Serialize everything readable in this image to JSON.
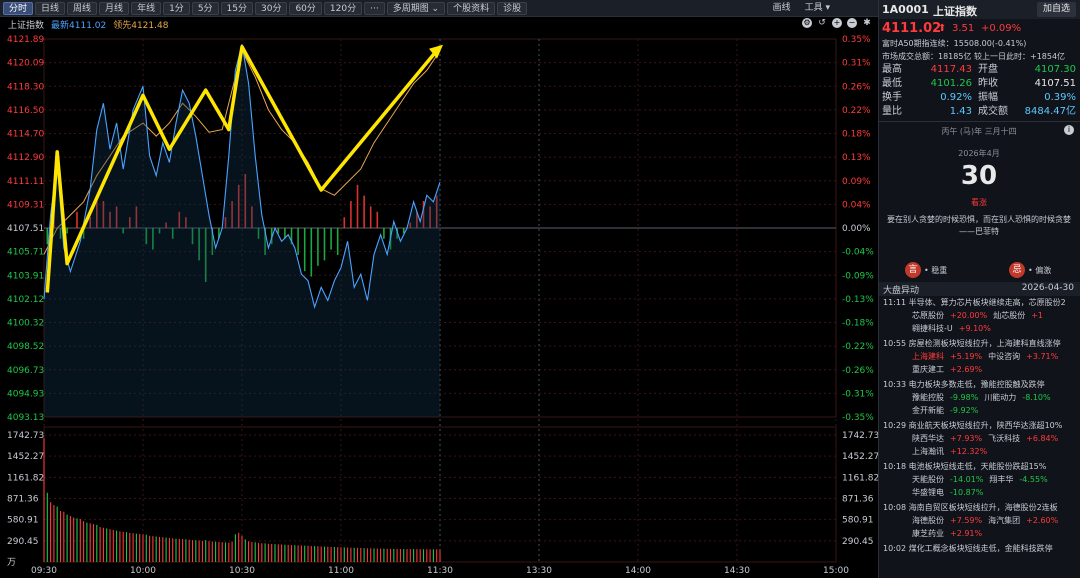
{
  "toolbar": {
    "tabs": [
      "分时",
      "日线",
      "周线",
      "月线",
      "年线",
      "1分",
      "5分",
      "15分",
      "30分",
      "60分",
      "120分",
      "···",
      "多周期图 ⌄",
      "个股资料",
      "诊股"
    ],
    "active_tab": 0,
    "right": [
      "画线",
      "工具 ▾"
    ]
  },
  "chart": {
    "index_name": "上证指数",
    "latest_label": "最新4111.02",
    "lead_label": "领先4121.48",
    "price_ticks": [
      "4121.89",
      "4120.09",
      "4118.30",
      "4116.50",
      "4114.70",
      "4112.90",
      "4111.11",
      "4109.31",
      "4107.51",
      "4105.71",
      "4103.91",
      "4102.12",
      "4100.32",
      "4098.52",
      "4096.73",
      "4094.93",
      "4093.13"
    ],
    "pct_ticks": [
      "0.35%",
      "0.31%",
      "0.26%",
      "0.22%",
      "0.18%",
      "0.13%",
      "0.09%",
      "0.04%",
      "0.00%",
      "-0.04%",
      "-0.09%",
      "-0.13%",
      "-0.18%",
      "-0.22%",
      "-0.26%",
      "-0.31%",
      "-0.35%"
    ],
    "vol_ticks": [
      "1742.73",
      "1452.27",
      "1161.82",
      "871.36",
      "580.91",
      "290.45",
      "万"
    ],
    "time_ticks": [
      "09:30",
      "10:00",
      "10:30",
      "11:00",
      "11:30",
      "13:30",
      "14:00",
      "14:30",
      "15:00"
    ],
    "prev_close": 4107.51,
    "colors": {
      "up": "#ff3b3b",
      "down": "#1ec74a",
      "price_line": "#4aa3ff",
      "avg_line": "#e8a64e",
      "annotation": "#ffe600"
    }
  },
  "chart_data": {
    "type": "line",
    "x_range": [
      "09:30",
      "15:00"
    ],
    "ylim": [
      4093.13,
      4121.89
    ],
    "price_series": [
      [
        "09:30",
        4102.1
      ],
      [
        "09:32",
        4108.5
      ],
      [
        "09:34",
        4112.5
      ],
      [
        "09:36",
        4106.0
      ],
      [
        "09:38",
        4104.2
      ],
      [
        "09:41",
        4106.5
      ],
      [
        "09:44",
        4110.5
      ],
      [
        "09:46",
        4115.0
      ],
      [
        "09:48",
        4117.0
      ],
      [
        "09:50",
        4113.5
      ],
      [
        "09:52",
        4115.5
      ],
      [
        "09:54",
        4112.0
      ],
      [
        "09:57",
        4116.5
      ],
      [
        "10:00",
        4118.3
      ],
      [
        "10:02",
        4113.0
      ],
      [
        "10:04",
        4111.5
      ],
      [
        "10:06",
        4114.0
      ],
      [
        "10:08",
        4112.5
      ],
      [
        "10:10",
        4115.5
      ],
      [
        "10:12",
        4118.0
      ],
      [
        "10:14",
        4117.0
      ],
      [
        "10:16",
        4114.5
      ],
      [
        "10:18",
        4111.5
      ],
      [
        "10:20",
        4108.5
      ],
      [
        "10:22",
        4106.0
      ],
      [
        "10:24",
        4107.5
      ],
      [
        "10:26",
        4113.0
      ],
      [
        "10:28",
        4119.5
      ],
      [
        "10:30",
        4121.5
      ],
      [
        "10:32",
        4118.5
      ],
      [
        "10:34",
        4113.0
      ],
      [
        "10:36",
        4108.5
      ],
      [
        "10:38",
        4106.0
      ],
      [
        "10:40",
        4107.5
      ],
      [
        "10:42",
        4106.5
      ],
      [
        "10:44",
        4107.0
      ],
      [
        "10:46",
        4106.0
      ],
      [
        "10:48",
        4104.0
      ],
      [
        "10:50",
        4103.5
      ],
      [
        "10:52",
        4101.5
      ],
      [
        "10:54",
        4103.0
      ],
      [
        "10:56",
        4102.0
      ],
      [
        "10:58",
        4103.5
      ],
      [
        "11:00",
        4104.5
      ],
      [
        "11:02",
        4106.5
      ],
      [
        "11:04",
        4103.0
      ],
      [
        "11:06",
        4104.0
      ],
      [
        "11:08",
        4102.0
      ],
      [
        "11:10",
        4105.5
      ],
      [
        "11:12",
        4107.0
      ],
      [
        "11:14",
        4105.5
      ],
      [
        "11:16",
        4108.0
      ],
      [
        "11:18",
        4106.5
      ],
      [
        "11:20",
        4107.5
      ],
      [
        "11:22",
        4109.5
      ],
      [
        "11:24",
        4108.0
      ],
      [
        "11:26",
        4110.0
      ],
      [
        "11:28",
        4109.5
      ],
      [
        "11:30",
        4111.0
      ]
    ],
    "avg_series": [
      [
        "09:30",
        4105.5
      ],
      [
        "09:34",
        4107.5
      ],
      [
        "09:38",
        4108.5
      ],
      [
        "09:42",
        4109.5
      ],
      [
        "09:46",
        4111.5
      ],
      [
        "09:50",
        4113.0
      ],
      [
        "09:54",
        4114.5
      ],
      [
        "10:00",
        4115.5
      ],
      [
        "10:04",
        4114.5
      ],
      [
        "10:08",
        4115.5
      ],
      [
        "10:12",
        4117.0
      ],
      [
        "10:16",
        4116.0
      ],
      [
        "10:20",
        4114.8
      ],
      [
        "10:24",
        4115.0
      ],
      [
        "10:28",
        4119.0
      ],
      [
        "10:30",
        4121.0
      ],
      [
        "10:34",
        4119.0
      ],
      [
        "10:38",
        4116.5
      ],
      [
        "10:42",
        4115.0
      ],
      [
        "10:46",
        4114.0
      ],
      [
        "10:50",
        4112.5
      ],
      [
        "10:54",
        4110.5
      ],
      [
        "10:58",
        4110.0
      ],
      [
        "11:02",
        4111.0
      ],
      [
        "11:06",
        4112.0
      ],
      [
        "11:10",
        4114.0
      ],
      [
        "11:14",
        4115.5
      ],
      [
        "11:18",
        4117.0
      ],
      [
        "11:22",
        4118.5
      ],
      [
        "11:26",
        4119.5
      ],
      [
        "11:30",
        4121.0
      ]
    ],
    "pct_bars": [
      [
        "09:31",
        -0.03
      ],
      [
        "09:33",
        0.05
      ],
      [
        "09:35",
        -0.02
      ],
      [
        "09:37",
        -0.01
      ],
      [
        "09:40",
        0.03
      ],
      [
        "09:42",
        -0.02
      ],
      [
        "09:44",
        0.02
      ],
      [
        "09:46",
        0.06
      ],
      [
        "09:48",
        0.05
      ],
      [
        "09:50",
        0.03
      ],
      [
        "09:52",
        0.04
      ],
      [
        "09:54",
        -0.01
      ],
      [
        "09:56",
        0.02
      ],
      [
        "09:58",
        0.04
      ],
      [
        "10:01",
        -0.03
      ],
      [
        "10:03",
        -0.04
      ],
      [
        "10:05",
        -0.01
      ],
      [
        "10:07",
        0.01
      ],
      [
        "10:09",
        -0.02
      ],
      [
        "10:11",
        0.03
      ],
      [
        "10:13",
        0.02
      ],
      [
        "10:15",
        -0.03
      ],
      [
        "10:17",
        -0.06
      ],
      [
        "10:19",
        -0.1
      ],
      [
        "10:21",
        -0.05
      ],
      [
        "10:23",
        -0.02
      ],
      [
        "10:25",
        0.02
      ],
      [
        "10:27",
        0.05
      ],
      [
        "10:29",
        0.08
      ],
      [
        "10:31",
        0.1
      ],
      [
        "10:33",
        0.04
      ],
      [
        "10:35",
        -0.02
      ],
      [
        "10:37",
        -0.05
      ],
      [
        "10:39",
        -0.03
      ],
      [
        "10:41",
        -0.01
      ],
      [
        "10:43",
        -0.02
      ],
      [
        "10:45",
        -0.03
      ],
      [
        "10:47",
        -0.05
      ],
      [
        "10:49",
        -0.08
      ],
      [
        "10:51",
        -0.09
      ],
      [
        "10:53",
        -0.07
      ],
      [
        "10:55",
        -0.06
      ],
      [
        "10:57",
        -0.04
      ],
      [
        "10:59",
        -0.05
      ],
      [
        "11:01",
        0.02
      ],
      [
        "11:03",
        0.05
      ],
      [
        "11:05",
        0.08
      ],
      [
        "11:07",
        0.06
      ],
      [
        "11:09",
        0.04
      ],
      [
        "11:11",
        0.03
      ],
      [
        "11:13",
        -0.02
      ],
      [
        "11:15",
        -0.04
      ],
      [
        "11:17",
        -0.02
      ],
      [
        "11:19",
        -0.01
      ],
      [
        "11:21",
        0.01
      ],
      [
        "11:23",
        0.03
      ],
      [
        "11:25",
        0.05
      ],
      [
        "11:27",
        0.04
      ],
      [
        "11:29",
        0.06
      ]
    ],
    "volume_series": [
      [
        "09:30",
        1700
      ],
      [
        "09:31",
        950
      ],
      [
        "09:32",
        820
      ],
      [
        "09:33",
        780
      ],
      [
        "09:34",
        760
      ],
      [
        "09:35",
        700
      ],
      [
        "09:36",
        690
      ],
      [
        "09:37",
        650
      ],
      [
        "09:38",
        630
      ],
      [
        "09:39",
        610
      ],
      [
        "09:40",
        600
      ],
      [
        "09:41",
        590
      ],
      [
        "09:42",
        560
      ],
      [
        "09:43",
        540
      ],
      [
        "09:44",
        530
      ],
      [
        "09:45",
        520
      ],
      [
        "09:46",
        510
      ],
      [
        "09:47",
        480
      ],
      [
        "09:48",
        470
      ],
      [
        "09:49",
        460
      ],
      [
        "09:50",
        450
      ],
      [
        "09:51",
        440
      ],
      [
        "09:52",
        430
      ],
      [
        "09:53",
        420
      ],
      [
        "09:54",
        415
      ],
      [
        "09:55",
        410
      ],
      [
        "09:56",
        400
      ],
      [
        "09:57",
        395
      ],
      [
        "09:58",
        390
      ],
      [
        "09:59",
        385
      ],
      [
        "10:00",
        380
      ],
      [
        "10:01",
        375
      ],
      [
        "10:02",
        360
      ],
      [
        "10:03",
        355
      ],
      [
        "10:04",
        350
      ],
      [
        "10:05",
        345
      ],
      [
        "10:06",
        340
      ],
      [
        "10:07",
        335
      ],
      [
        "10:08",
        330
      ],
      [
        "10:09",
        325
      ],
      [
        "10:10",
        320
      ],
      [
        "10:11",
        318
      ],
      [
        "10:12",
        315
      ],
      [
        "10:13",
        312
      ],
      [
        "10:14",
        305
      ],
      [
        "10:15",
        300
      ],
      [
        "10:16",
        298
      ],
      [
        "10:17",
        295
      ],
      [
        "10:18",
        290
      ],
      [
        "10:19",
        300
      ],
      [
        "10:20",
        285
      ],
      [
        "10:21",
        280
      ],
      [
        "10:22",
        278
      ],
      [
        "10:23",
        275
      ],
      [
        "10:24",
        272
      ],
      [
        "10:25",
        268
      ],
      [
        "10:26",
        265
      ],
      [
        "10:27",
        280
      ],
      [
        "10:28",
        380
      ],
      [
        "10:29",
        400
      ],
      [
        "10:30",
        360
      ],
      [
        "10:31",
        310
      ],
      [
        "10:32",
        285
      ],
      [
        "10:33",
        275
      ],
      [
        "10:34",
        270
      ],
      [
        "10:35",
        262
      ],
      [
        "10:36",
        258
      ],
      [
        "10:37",
        255
      ],
      [
        "10:38",
        250
      ],
      [
        "10:39",
        248
      ],
      [
        "10:40",
        245
      ],
      [
        "10:41",
        242
      ],
      [
        "10:42",
        240
      ],
      [
        "10:43",
        238
      ],
      [
        "10:44",
        235
      ],
      [
        "10:45",
        232
      ],
      [
        "10:46",
        230
      ],
      [
        "10:47",
        228
      ],
      [
        "10:48",
        226
      ],
      [
        "10:49",
        224
      ],
      [
        "10:50",
        222
      ],
      [
        "10:51",
        220
      ],
      [
        "10:52",
        218
      ],
      [
        "10:53",
        216
      ],
      [
        "10:54",
        214
      ],
      [
        "10:55",
        212
      ],
      [
        "10:56",
        210
      ],
      [
        "10:57",
        208
      ],
      [
        "10:58",
        206
      ],
      [
        "10:59",
        204
      ],
      [
        "11:00",
        202
      ],
      [
        "11:01",
        200
      ],
      [
        "11:02",
        198
      ],
      [
        "11:03",
        196
      ],
      [
        "11:04",
        195
      ],
      [
        "11:05",
        194
      ],
      [
        "11:06",
        192
      ],
      [
        "11:07",
        190
      ],
      [
        "11:08",
        188
      ],
      [
        "11:09",
        187
      ],
      [
        "11:10",
        186
      ],
      [
        "11:11",
        185
      ],
      [
        "11:12",
        184
      ],
      [
        "11:13",
        183
      ],
      [
        "11:14",
        182
      ],
      [
        "11:15",
        181
      ],
      [
        "11:16",
        180
      ],
      [
        "11:17",
        180
      ],
      [
        "11:18",
        179
      ],
      [
        "11:19",
        178
      ],
      [
        "11:20",
        178
      ],
      [
        "11:21",
        177
      ],
      [
        "11:22",
        177
      ],
      [
        "11:23",
        176
      ],
      [
        "11:24",
        176
      ],
      [
        "11:25",
        175
      ],
      [
        "11:26",
        175
      ],
      [
        "11:27",
        174
      ],
      [
        "11:28",
        174
      ],
      [
        "11:29",
        173
      ],
      [
        "11:30",
        173
      ]
    ]
  },
  "right_panel": {
    "code": "1A0001",
    "name": "上证指数",
    "watch_label": "加自选",
    "last_price": "4111.02",
    "arrow": "⬆",
    "change": "3.51",
    "change_pct": "+0.09%",
    "a50_line": "富时A50期指连续：15508.00(-0.41%)",
    "turnover_line": "市场成交总额：18185亿 较上一日此时：+1854亿",
    "quote": [
      {
        "l1": "最高",
        "v1": "4117.43",
        "c1": "up",
        "l2": "开盘",
        "v2": "4107.30",
        "c2": "down"
      },
      {
        "l1": "最低",
        "v1": "4101.26",
        "c1": "down",
        "l2": "昨收",
        "v2": "4107.51",
        "c2": "white"
      },
      {
        "l1": "换手",
        "v1": "0.92%",
        "c1": "cyan",
        "l2": "振幅",
        "v2": "0.39%",
        "c2": "cyan"
      },
      {
        "l1": "量比",
        "v1": "1.43",
        "c1": "cyan",
        "l2": "成交额",
        "v2": "8484.47亿",
        "c2": "cyan"
      }
    ],
    "calendar": {
      "lunar": "丙午 (马)年 三月十四",
      "month": "2026年4月",
      "day": "30",
      "sub": "看涨",
      "quote": "要在别人贪婪的时候恐惧，而在别人恐惧的时候贪婪——巴菲特"
    },
    "actions": [
      {
        "badge": "言",
        "label": "• 稳重"
      },
      {
        "badge": "忌",
        "label": "• 偏激"
      }
    ],
    "news_title": "大盘异动",
    "news_date": "2026-04-30",
    "news": [
      {
        "headline": "11:11 半导体、算力芯片板块继续走高，芯原股份2",
        "lines": [
          [
            [
              "芯原股份",
              "sname"
            ],
            [
              "+20.00%",
              "up"
            ],
            [
              "灿芯股份",
              "sname"
            ],
            [
              "+1",
              "up"
            ]
          ],
          [
            [
              "翱捷科技-U",
              "sname"
            ],
            [
              "+9.10%",
              "up"
            ]
          ]
        ]
      },
      {
        "headline": "10:55 房屋检测板块短线拉升，上海建科直线涨停",
        "lines": [
          [
            [
              "上海建科",
              "up"
            ],
            [
              "+5.19%",
              "up"
            ],
            [
              "中设咨询",
              "sname"
            ],
            [
              "+3.71%",
              "up"
            ]
          ],
          [
            [
              "重庆建工",
              "sname"
            ],
            [
              "+2.69%",
              "up"
            ]
          ]
        ]
      },
      {
        "headline": "10:33 电力板块多数走低，豫能控股触及跌停",
        "lines": [
          [
            [
              "豫能控股",
              "sname"
            ],
            [
              "-9.98%",
              "down"
            ],
            [
              "川能动力",
              "sname"
            ],
            [
              "-8.10%",
              "down"
            ]
          ],
          [
            [
              "金开新能",
              "sname"
            ],
            [
              "-9.92%",
              "down"
            ]
          ]
        ]
      },
      {
        "headline": "10:29 商业航天板块短线拉升，陕西华达涨超10%",
        "lines": [
          [
            [
              "陕西华达",
              "sname"
            ],
            [
              "+7.93%",
              "up"
            ],
            [
              "飞沃科技",
              "sname"
            ],
            [
              "+6.84%",
              "up"
            ]
          ],
          [
            [
              "上海瀚讯",
              "sname"
            ],
            [
              "+12.32%",
              "up"
            ]
          ]
        ]
      },
      {
        "headline": "10:18 电池板块短线走低，天能股份跌超15%",
        "lines": [
          [
            [
              "天能股份",
              "sname"
            ],
            [
              "-14.01%",
              "down"
            ],
            [
              "翔丰华",
              "sname"
            ],
            [
              "-4.55%",
              "down"
            ]
          ],
          [
            [
              "华盛锂电",
              "sname"
            ],
            [
              "-10.87%",
              "down"
            ]
          ]
        ]
      },
      {
        "headline": "10:08 海南自贸区板块短线拉升，海德股份2连板",
        "lines": [
          [
            [
              "海德股份",
              "sname"
            ],
            [
              "+7.59%",
              "up"
            ],
            [
              "海汽集团",
              "sname"
            ],
            [
              "+2.60%",
              "up"
            ]
          ],
          [
            [
              "康芝药业",
              "sname"
            ],
            [
              "+2.91%",
              "up"
            ]
          ]
        ]
      },
      {
        "headline": "10:02 煤化工概念板块短线走低，金能科技跌停",
        "lines": []
      }
    ]
  }
}
